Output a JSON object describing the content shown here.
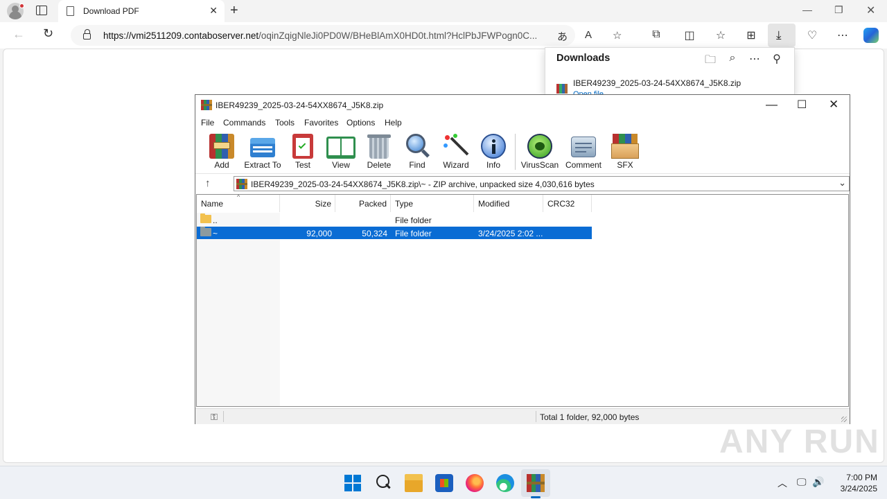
{
  "browser": {
    "tab_title": "Download PDF",
    "url_host": "https://vmi2511209.contaboserver.net",
    "url_path": "/oqinZqigNleJi0PD0W/BHeBlAmX0HD0t.html?HclPbJFWPogn0C..."
  },
  "downloads": {
    "title": "Downloads",
    "items": [
      {
        "filename": "IBER49239_2025-03-24-54XX8674_J5K8.zip",
        "action": "Open file"
      }
    ]
  },
  "winrar": {
    "window_title": "IBER49239_2025-03-24-54XX8674_J5K8.zip",
    "menu": [
      "File",
      "Commands",
      "Tools",
      "Favorites",
      "Options",
      "Help"
    ],
    "toolbar": {
      "add": "Add",
      "extract_to": "Extract To",
      "test": "Test",
      "view": "View",
      "delete": "Delete",
      "find": "Find",
      "wizard": "Wizard",
      "info": "Info",
      "virusscan": "VirusScan",
      "comment": "Comment",
      "sfx": "SFX"
    },
    "path": "IBER49239_2025-03-24-54XX8674_J5K8.zip\\~ - ZIP archive, unpacked size 4,030,616 bytes",
    "columns": {
      "name": "Name",
      "size": "Size",
      "packed": "Packed",
      "type": "Type",
      "modified": "Modified",
      "crc32": "CRC32"
    },
    "rows": [
      {
        "name": "..",
        "size": "",
        "packed": "",
        "type": "File folder",
        "modified": "",
        "crc32": "",
        "selected": false
      },
      {
        "name": "~",
        "size": "92,000",
        "packed": "50,324",
        "type": "File folder",
        "modified": "3/24/2025 2:02 ...",
        "crc32": "",
        "selected": true
      }
    ],
    "status": "Total 1 folder, 92,000 bytes"
  },
  "watermark": "ANY RUN",
  "taskbar": {
    "time": "7:00 PM",
    "date": "3/24/2025"
  },
  "colors": {
    "selection": "#0a6cd4",
    "accent": "#0067c0",
    "folder_yellow": "#f2c14e",
    "folder_gray": "#8c9ba0"
  }
}
